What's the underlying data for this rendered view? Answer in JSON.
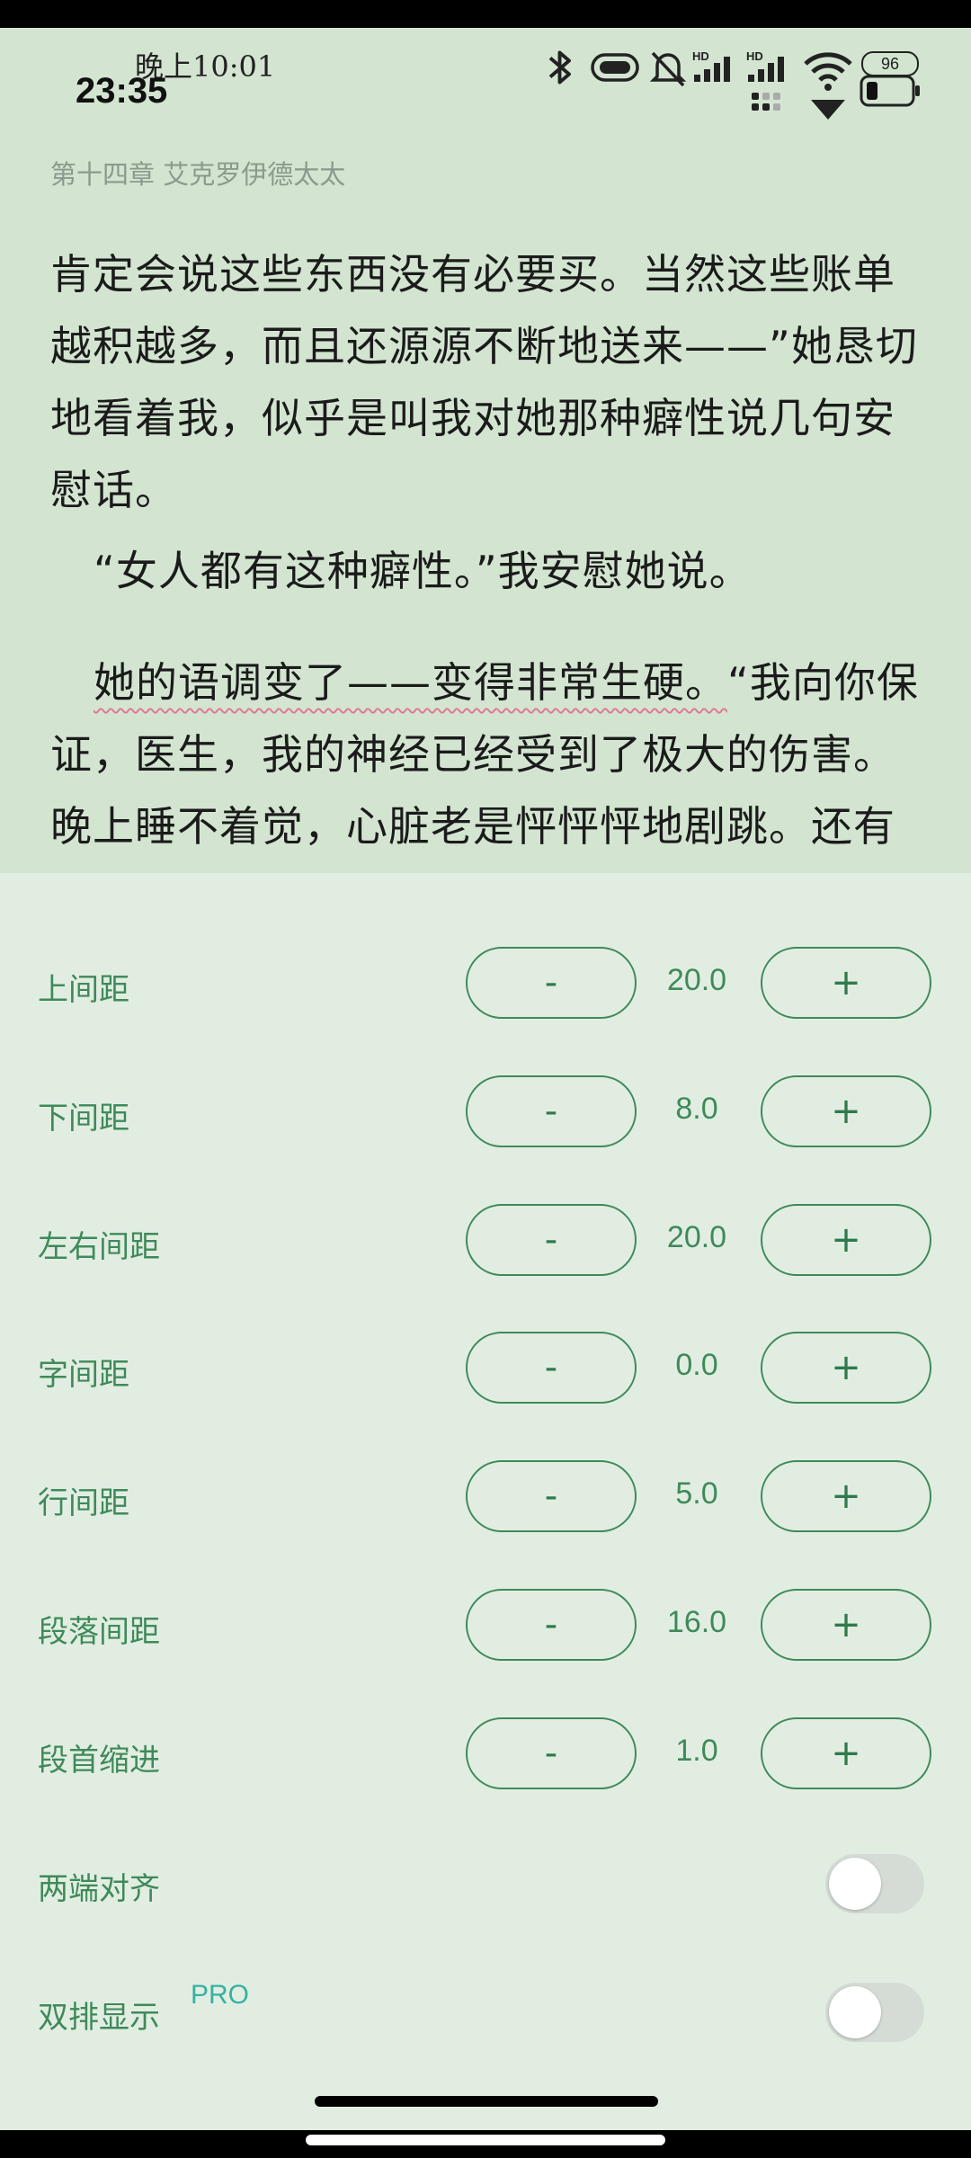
{
  "status_bar": {
    "time_small": "晚上10:01",
    "time_big": "23:35",
    "battery": "96"
  },
  "reader": {
    "chapter_title": "第十四章 艾克罗伊德太太",
    "para1": "肯定会说这些东西没有必要买。当然这些账单越积越多，而且还源源不断地送来——”她恳切地看着我，似乎是叫我对她那种癖性说几句安慰话。",
    "para2": "“女人都有这种癖性。”我安慰她说。",
    "para3_underlined": "她的语调变了——变得非常生硬。",
    "para3_rest": "“我向你保证，医生，我的神经已经受到了极大的伤害。晚上睡不着觉，心脏老是怦怦怦地剧跳。还有"
  },
  "settings": {
    "minus_label": "-",
    "plus_label": "+",
    "rows": [
      {
        "label": "上间距",
        "value": "20.0"
      },
      {
        "label": "下间距",
        "value": "8.0"
      },
      {
        "label": "左右间距",
        "value": "20.0"
      },
      {
        "label": "字间距",
        "value": "0.0"
      },
      {
        "label": "行间距",
        "value": "5.0"
      },
      {
        "label": "段落间距",
        "value": "16.0"
      },
      {
        "label": "段首缩进",
        "value": "1.0"
      }
    ],
    "toggles": [
      {
        "label": "两端对齐",
        "on": false
      },
      {
        "label": "双排显示",
        "badge": "PRO",
        "on": false
      }
    ]
  }
}
